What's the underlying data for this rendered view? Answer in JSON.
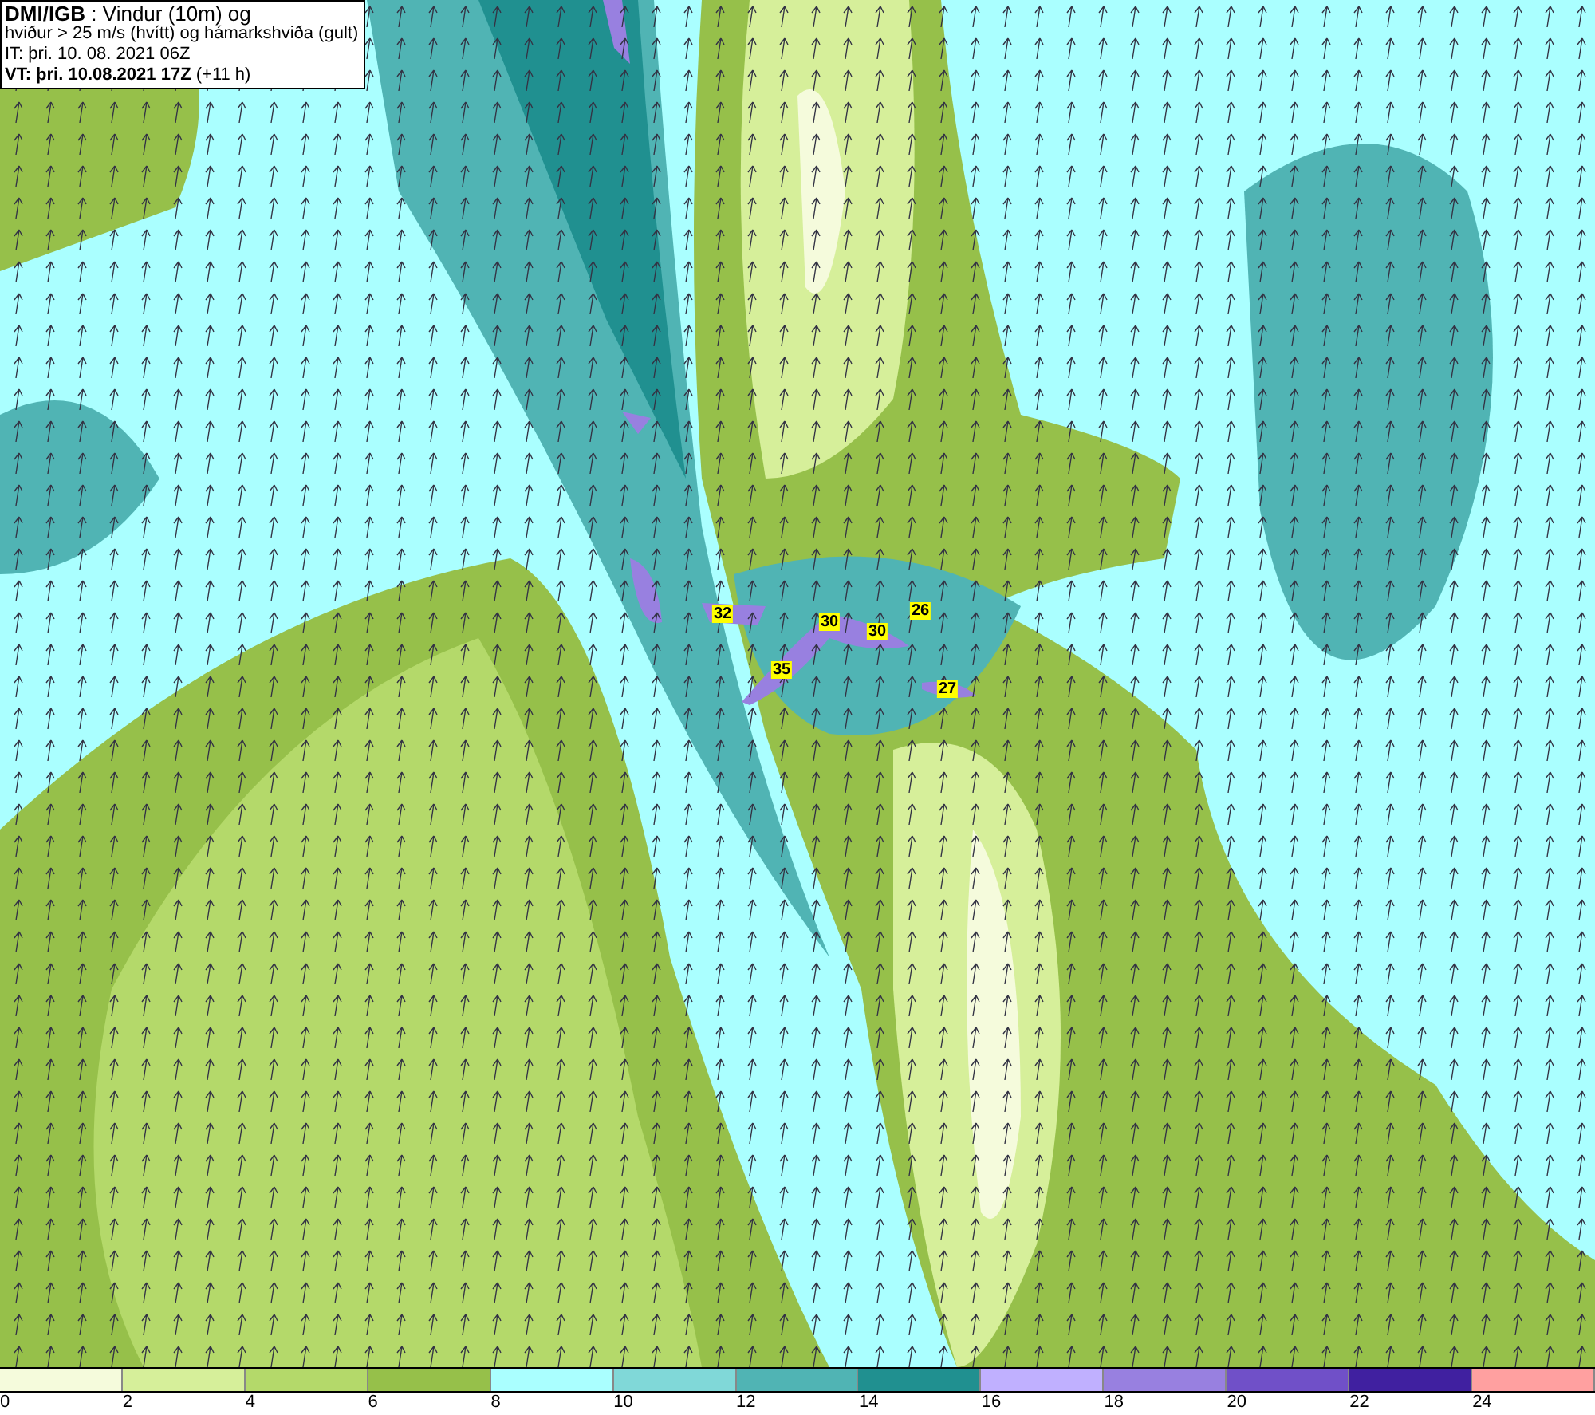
{
  "header": {
    "lines": [
      "**DMI/IGB** : Vindur (10m) og",
      "hviður > 25 m/s (hvítt) og hámarkshviða (gult)",
      "IT: þri. 10. 08. 2021 06Z",
      "**VT: þri. 10.08.2021 17Z** (+11 h)"
    ]
  },
  "gust_labels": [
    {
      "value": "32"
    },
    {
      "value": "30"
    },
    {
      "value": "30"
    },
    {
      "value": "26"
    },
    {
      "value": "35"
    },
    {
      "value": "27"
    }
  ],
  "legend": {
    "swatches": [
      {
        "color": "#f5fbdc"
      },
      {
        "color": "#d6ef9a"
      },
      {
        "color": "#b4d96a"
      },
      {
        "color": "#96c04a"
      },
      {
        "color": "#aaffff"
      },
      {
        "color": "#80d8d8"
      },
      {
        "color": "#50b4b4"
      },
      {
        "color": "#209090"
      },
      {
        "color": "#c0b0ff"
      },
      {
        "color": "#9880e0"
      },
      {
        "color": "#7050c8"
      },
      {
        "color": "#4020a0"
      },
      {
        "color": "#ffa0a0"
      }
    ],
    "ticks": [
      "0",
      "2",
      "4",
      "6",
      "8",
      "10",
      "12",
      "14",
      "16",
      "18",
      "20",
      "22",
      "24"
    ]
  }
}
